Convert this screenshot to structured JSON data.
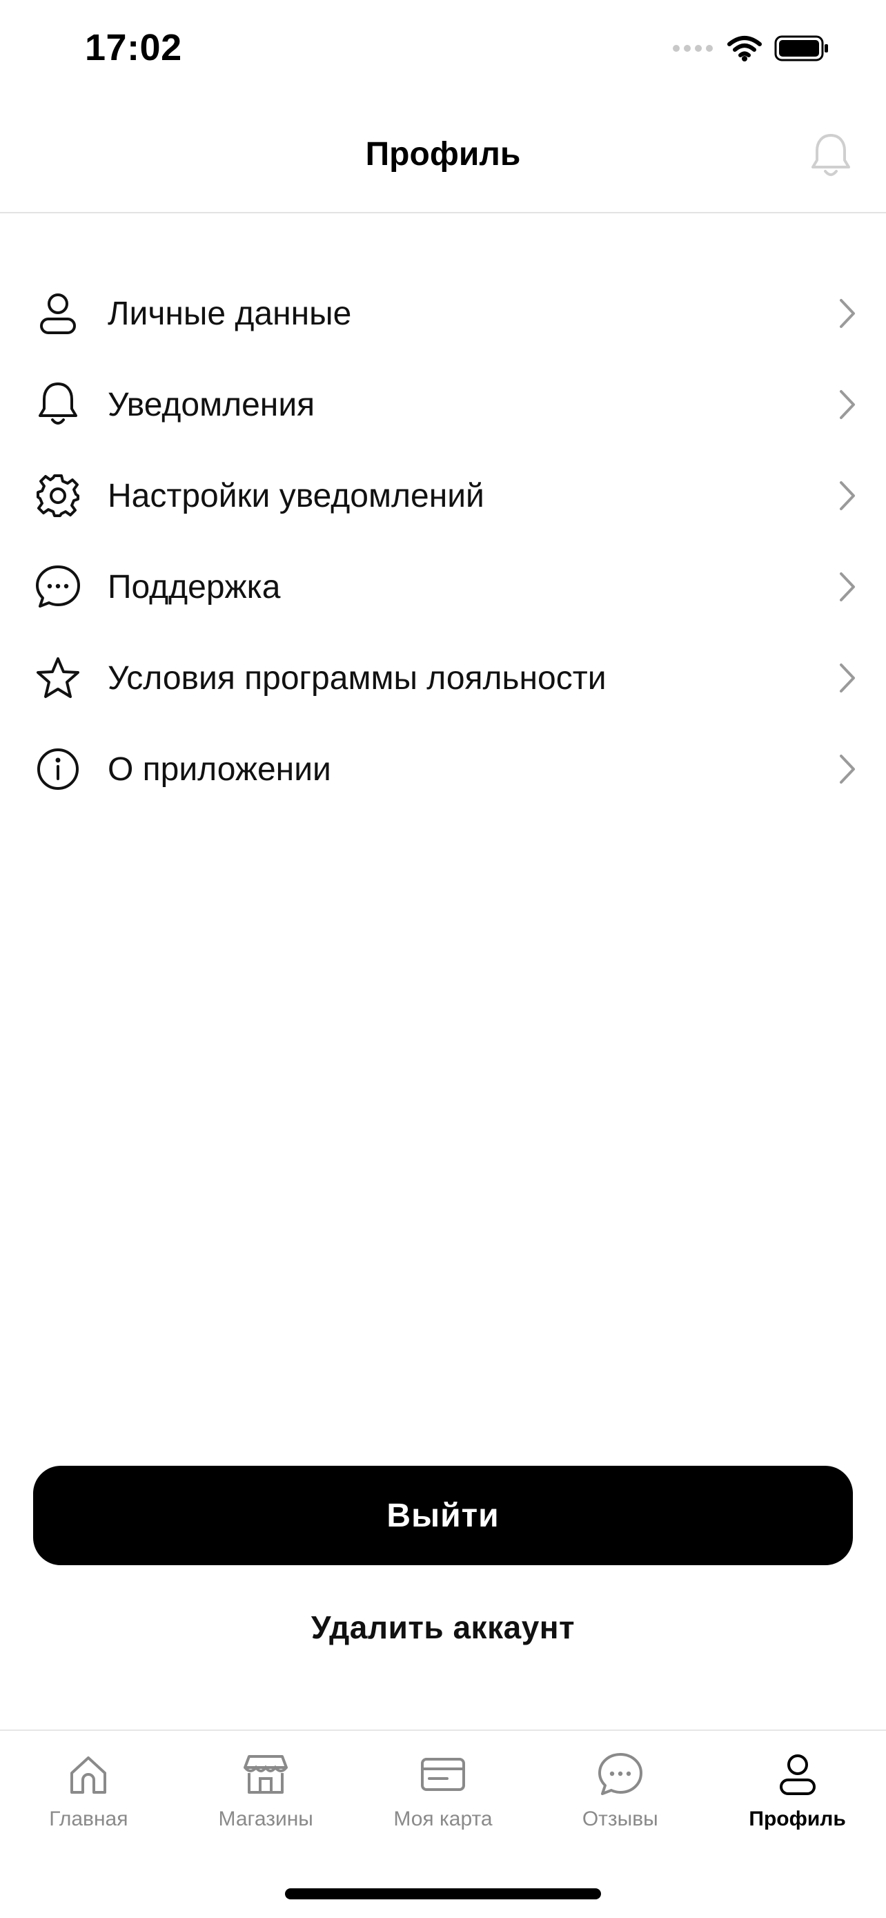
{
  "status_bar": {
    "time": "17:02",
    "icons": [
      "cellular-icon",
      "wifi-icon",
      "battery-icon"
    ]
  },
  "header": {
    "title": "Профиль",
    "icon": "bell-icon"
  },
  "menu": [
    {
      "label": "Личные данные",
      "icon": "user-icon"
    },
    {
      "label": "Уведомления",
      "icon": "bell-icon"
    },
    {
      "label": "Настройки уведомлений",
      "icon": "gear-icon"
    },
    {
      "label": "Поддержка",
      "icon": "chat-icon"
    },
    {
      "label": "Условия программы лояльности",
      "icon": "star-icon"
    },
    {
      "label": "О приложении",
      "icon": "info-icon"
    }
  ],
  "actions": {
    "logout_label": "Выйти",
    "delete_label": "Удалить аккаунт"
  },
  "tabbar": [
    {
      "label": "Главная",
      "icon": "home-icon",
      "active": false
    },
    {
      "label": "Магазины",
      "icon": "store-icon",
      "active": false
    },
    {
      "label": "Моя карта",
      "icon": "card-icon",
      "active": false
    },
    {
      "label": "Отзывы",
      "icon": "chat-icon",
      "active": false
    },
    {
      "label": "Профиль",
      "icon": "user-icon",
      "active": true
    }
  ],
  "colors": {
    "primary": "#000000",
    "inactive": "#8a8a8a",
    "divider": "#e3e3e3"
  }
}
